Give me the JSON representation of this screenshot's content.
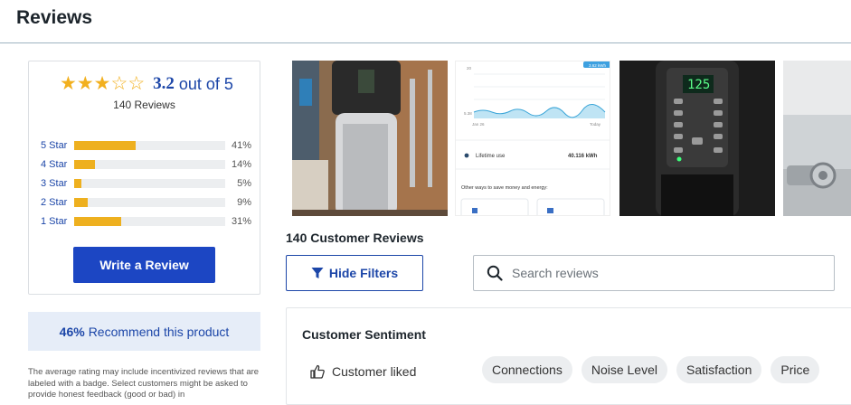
{
  "page": {
    "heading": "Reviews"
  },
  "rating": {
    "average": "3.2",
    "out_of_text": "out of 5",
    "stars_filled": 3,
    "stars_total": 5,
    "review_count_text": "140 Reviews",
    "accent_color": "#f2b01e",
    "distribution": [
      {
        "label": "5 Star",
        "pct_text": "41%",
        "fraction": 0.41
      },
      {
        "label": "4 Star",
        "pct_text": "14%",
        "fraction": 0.14
      },
      {
        "label": "3 Star",
        "pct_text": "5%",
        "fraction": 0.05
      },
      {
        "label": "2 Star",
        "pct_text": "9%",
        "fraction": 0.09
      },
      {
        "label": "1 Star",
        "pct_text": "31%",
        "fraction": 0.31
      }
    ]
  },
  "write_review_label": "Write a Review",
  "recommend": {
    "pct": "46%",
    "text": "Recommend this product"
  },
  "disclaimer": "The average rating may include incentivized reviews that are labeled with a badge. Select customers might be asked to provide honest feedback (good or bad) in",
  "photo2": {
    "chart_badge": "3.62 kWh",
    "y_top": "20",
    "y_mid": "5.38",
    "x_left": "Jan 26",
    "x_right": "Today",
    "lifetime_label": "Lifetime use",
    "lifetime_value": "40.116 kWh",
    "ways_text": "Other ways to save money and energy:"
  },
  "photo3": {
    "display_value": "125"
  },
  "reviews_title": "140 Customer Reviews",
  "filters_label": "Hide Filters",
  "search": {
    "placeholder": "Search reviews",
    "value": ""
  },
  "sentiment": {
    "title": "Customer Sentiment",
    "liked_label": "Customer liked",
    "chips": [
      "Connections",
      "Noise Level",
      "Satisfaction",
      "Price"
    ]
  },
  "colors": {
    "brand_blue": "#1c46c3",
    "link_blue": "#1c46a8",
    "bar_fill": "#eeb01f",
    "recommend_bg": "#e6edf8"
  }
}
